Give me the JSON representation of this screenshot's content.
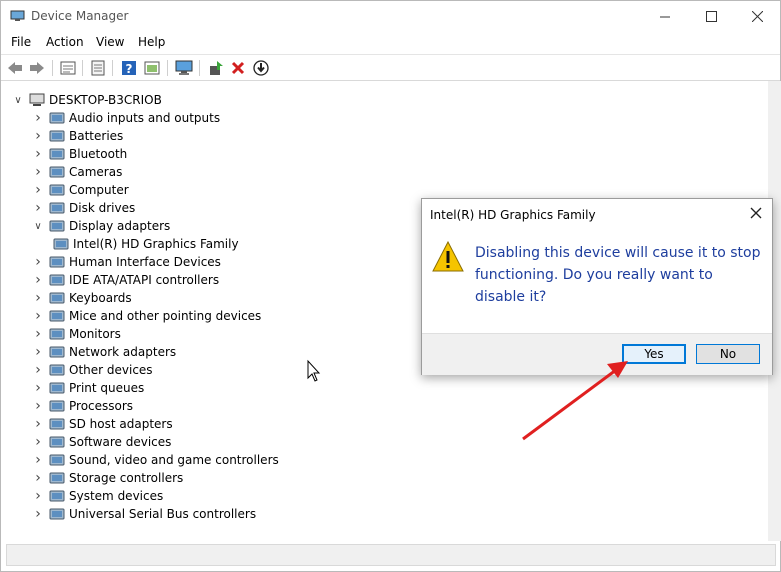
{
  "window": {
    "title": "Device Manager",
    "controls": [
      "minimize",
      "maximize",
      "close"
    ]
  },
  "menu": [
    "File",
    "Action",
    "View",
    "Help"
  ],
  "toolbar": [
    "back-icon",
    "forward-icon",
    "properties-icon",
    "update-driver-icon",
    "help-icon",
    "show-hidden-icon",
    "monitor-icon",
    "enable-device-icon",
    "uninstall-icon",
    "disable-device-icon"
  ],
  "tree": {
    "root": "DESKTOP-B3CRIOB",
    "items": [
      {
        "label": "Audio inputs and outputs",
        "icon": "speaker-icon",
        "expanded": false
      },
      {
        "label": "Batteries",
        "icon": "battery-icon",
        "expanded": false
      },
      {
        "label": "Bluetooth",
        "icon": "bluetooth-icon",
        "expanded": false
      },
      {
        "label": "Cameras",
        "icon": "camera-icon",
        "expanded": false
      },
      {
        "label": "Computer",
        "icon": "computer-icon",
        "expanded": false
      },
      {
        "label": "Disk drives",
        "icon": "disk-icon",
        "expanded": false
      },
      {
        "label": "Display adapters",
        "icon": "display-adapter-icon",
        "expanded": true
      },
      {
        "label": "Intel(R) HD Graphics Family",
        "icon": "display-adapter-icon",
        "child": true
      },
      {
        "label": "Human Interface Devices",
        "icon": "hid-icon",
        "expanded": false
      },
      {
        "label": "IDE ATA/ATAPI controllers",
        "icon": "ide-icon",
        "expanded": false
      },
      {
        "label": "Keyboards",
        "icon": "keyboard-icon",
        "expanded": false
      },
      {
        "label": "Mice and other pointing devices",
        "icon": "mouse-icon",
        "expanded": false
      },
      {
        "label": "Monitors",
        "icon": "monitor-icon",
        "expanded": false
      },
      {
        "label": "Network adapters",
        "icon": "network-icon",
        "expanded": false
      },
      {
        "label": "Other devices",
        "icon": "other-devices-icon",
        "expanded": false
      },
      {
        "label": "Print queues",
        "icon": "printer-icon",
        "expanded": false
      },
      {
        "label": "Processors",
        "icon": "processor-icon",
        "expanded": false
      },
      {
        "label": "SD host adapters",
        "icon": "sd-icon",
        "expanded": false
      },
      {
        "label": "Software devices",
        "icon": "software-icon",
        "expanded": false
      },
      {
        "label": "Sound, video and game controllers",
        "icon": "sound-icon",
        "expanded": false
      },
      {
        "label": "Storage controllers",
        "icon": "storage-icon",
        "expanded": false
      },
      {
        "label": "System devices",
        "icon": "system-icon",
        "expanded": false
      },
      {
        "label": "Universal Serial Bus controllers",
        "icon": "usb-icon",
        "expanded": false
      }
    ]
  },
  "dialog": {
    "title": "Intel(R) HD Graphics Family",
    "message": "Disabling this device will cause it to stop functioning. Do you really want to disable it?",
    "yes_label": "Yes",
    "no_label": "No"
  },
  "colors": {
    "accent": "#0078d7",
    "message": "#1e3e9e",
    "annotation_arrow": "#e02020"
  }
}
